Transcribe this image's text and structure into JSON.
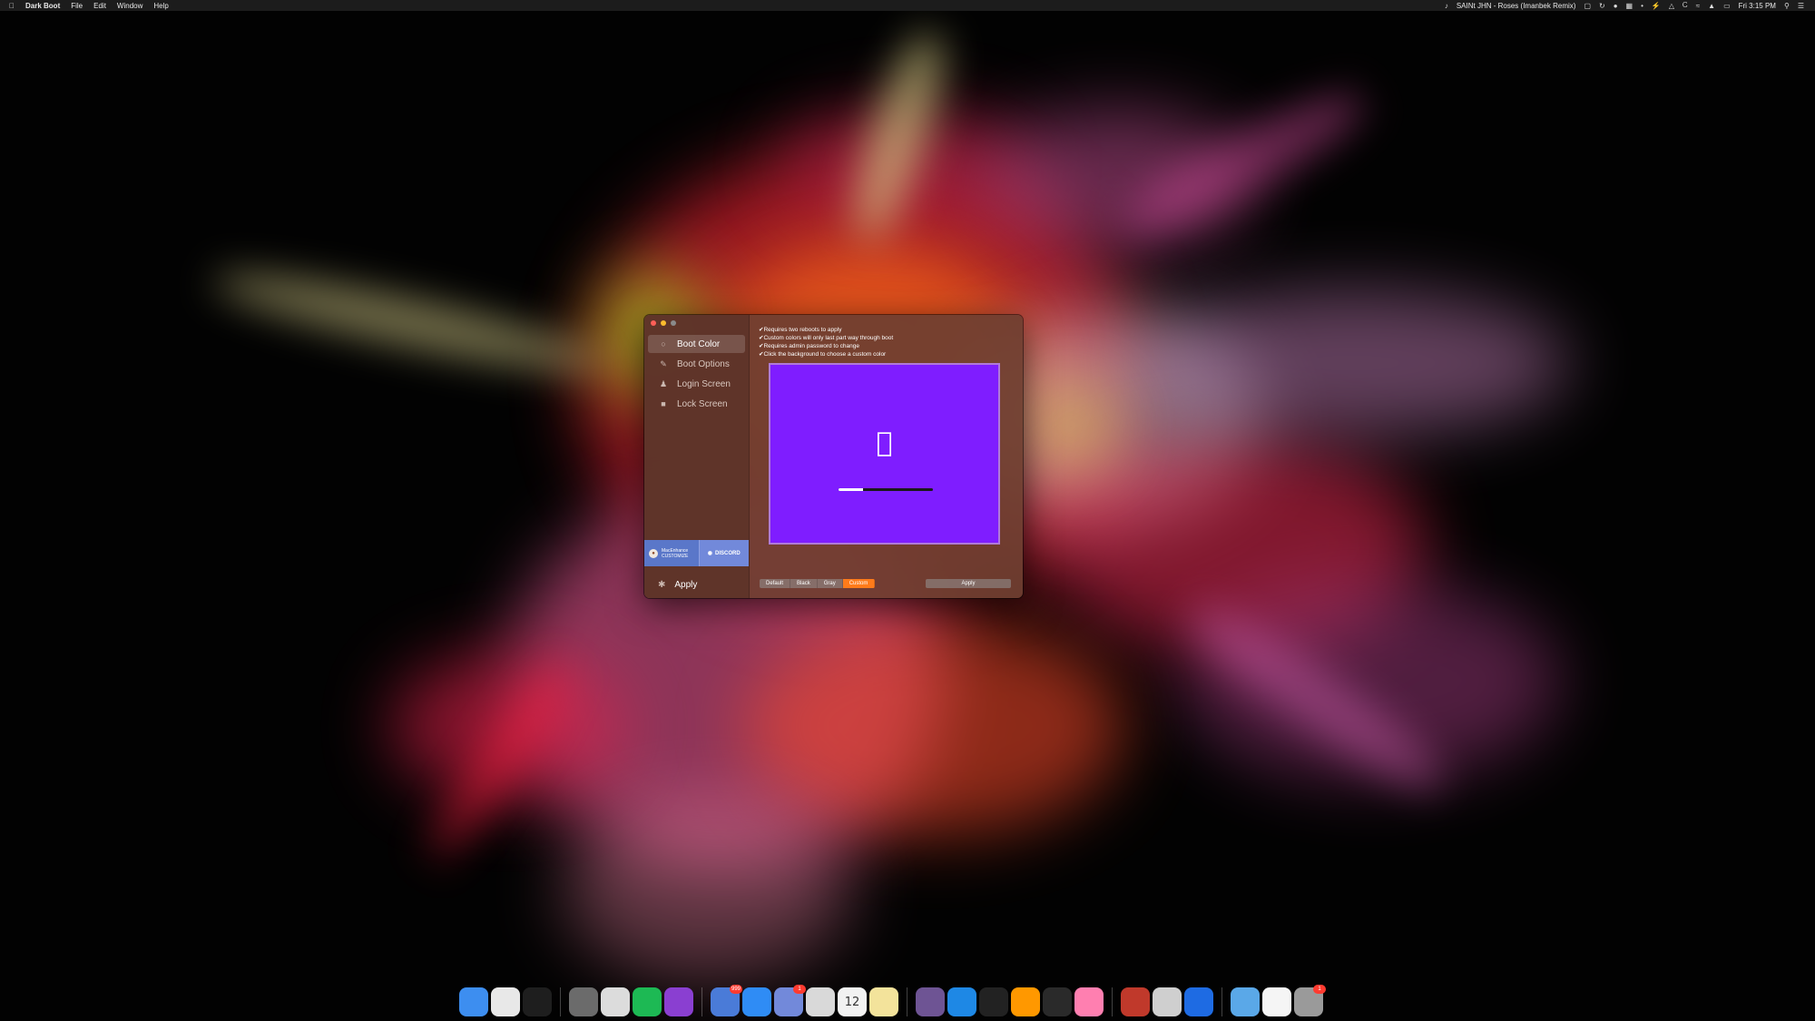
{
  "menubar": {
    "apple": "",
    "app_name": "Dark Boot",
    "menus": [
      "File",
      "Edit",
      "Window",
      "Help"
    ],
    "now_playing": "SAINt JHN - Roses (Imanbek Remix)",
    "clock": "Fri 3:15 PM"
  },
  "window": {
    "sidebar": {
      "items": [
        {
          "label": "Boot Color",
          "icon": "circle-icon"
        },
        {
          "label": "Boot Options",
          "icon": "edit-icon"
        },
        {
          "label": "Login Screen",
          "icon": "user-icon"
        },
        {
          "label": "Lock Screen",
          "icon": "lock-icon"
        }
      ],
      "banner_macenhance_line1": "MacEnhance",
      "banner_macenhance_line2": "CUSTOMIZE",
      "banner_discord": "DISCORD",
      "apply_label": "Apply"
    },
    "notes": [
      "Requires two reboots to apply",
      "Custom colors will only last part way through boot",
      "Requires admin password to change",
      "Click the background to choose a custom color"
    ],
    "preview": {
      "background_color": "#7f1dff",
      "apple_glyph": "",
      "progress": 0.26
    },
    "color_options": [
      "Default",
      "Black",
      "Gray",
      "Custom"
    ],
    "selected_color_option": "Custom",
    "apply_button": "Apply"
  },
  "dock": {
    "apps": [
      {
        "name": "finder-icon",
        "color": "#3d8ef0"
      },
      {
        "name": "chrome-icon",
        "color": "#e8e8e8"
      },
      {
        "name": "activity-monitor-icon",
        "color": "#1e1e1e"
      },
      {
        "name": "system-preferences-icon",
        "color": "#6b6b6b"
      },
      {
        "name": "alfred-icon",
        "color": "#dcdcdc"
      },
      {
        "name": "spotify-icon",
        "color": "#1db954"
      },
      {
        "name": "podcasts-icon",
        "color": "#8a3fd1"
      },
      {
        "name": "preview-icon",
        "color": "#4a7bd8",
        "badge": "999"
      },
      {
        "name": "messages-icon",
        "color": "#2f8cf5"
      },
      {
        "name": "discord-icon",
        "color": "#7289da",
        "badge": "1"
      },
      {
        "name": "photos-icon",
        "color": "#d9d9d9"
      },
      {
        "name": "calendar-icon",
        "color": "#f2f2f2",
        "text": "12"
      },
      {
        "name": "notes-icon",
        "color": "#f3e39b"
      },
      {
        "name": "github-desktop-icon",
        "color": "#6e5494"
      },
      {
        "name": "xcode-icon",
        "color": "#1e88e5"
      },
      {
        "name": "terminal-icon",
        "color": "#222"
      },
      {
        "name": "sublime-text-icon",
        "color": "#ff9800"
      },
      {
        "name": "console-icon",
        "color": "#2a2a2a"
      },
      {
        "name": "sketch-icon",
        "color": "#ff7fb0"
      },
      {
        "name": "no-entry-app-icon",
        "color": "#c0392b"
      },
      {
        "name": "display-app-icon",
        "color": "#cfcfcf"
      },
      {
        "name": "xcode-instruments-icon",
        "color": "#1e6be3"
      },
      {
        "name": "downloads-folder-icon",
        "color": "#5aa8e8"
      },
      {
        "name": "document-icon",
        "color": "#f5f5f5"
      },
      {
        "name": "trash-icon",
        "color": "#9a9a9a",
        "badge": "1"
      }
    ]
  }
}
